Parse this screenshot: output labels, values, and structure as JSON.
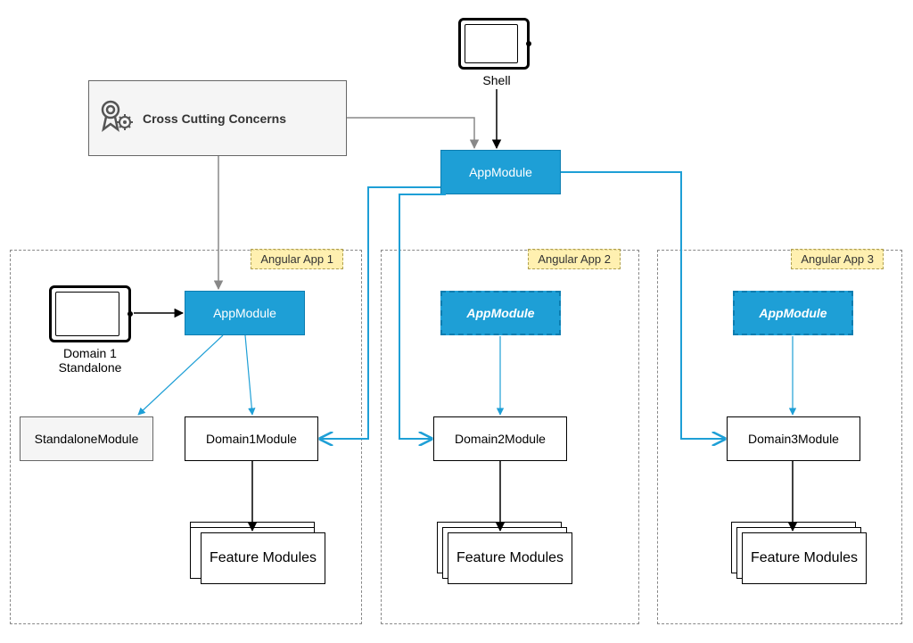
{
  "cross_cutting": "Cross Cutting Concerns",
  "shell_label": "Shell",
  "top_appmodule": "AppModule",
  "domain1_standalone_label": "Domain 1\nStandalone",
  "app1": {
    "container_label": "Angular App 1",
    "appmodule": "AppModule",
    "standalone_module": "StandaloneModule",
    "domain_module": "Domain1Module",
    "feature_modules": "Feature Modules"
  },
  "app2": {
    "container_label": "Angular App 2",
    "appmodule": "AppModule",
    "domain_module": "Domain2Module",
    "feature_modules": "Feature Modules"
  },
  "app3": {
    "container_label": "Angular App 3",
    "appmodule": "AppModule",
    "domain_module": "Domain3Module",
    "feature_modules": "Feature Modules"
  }
}
